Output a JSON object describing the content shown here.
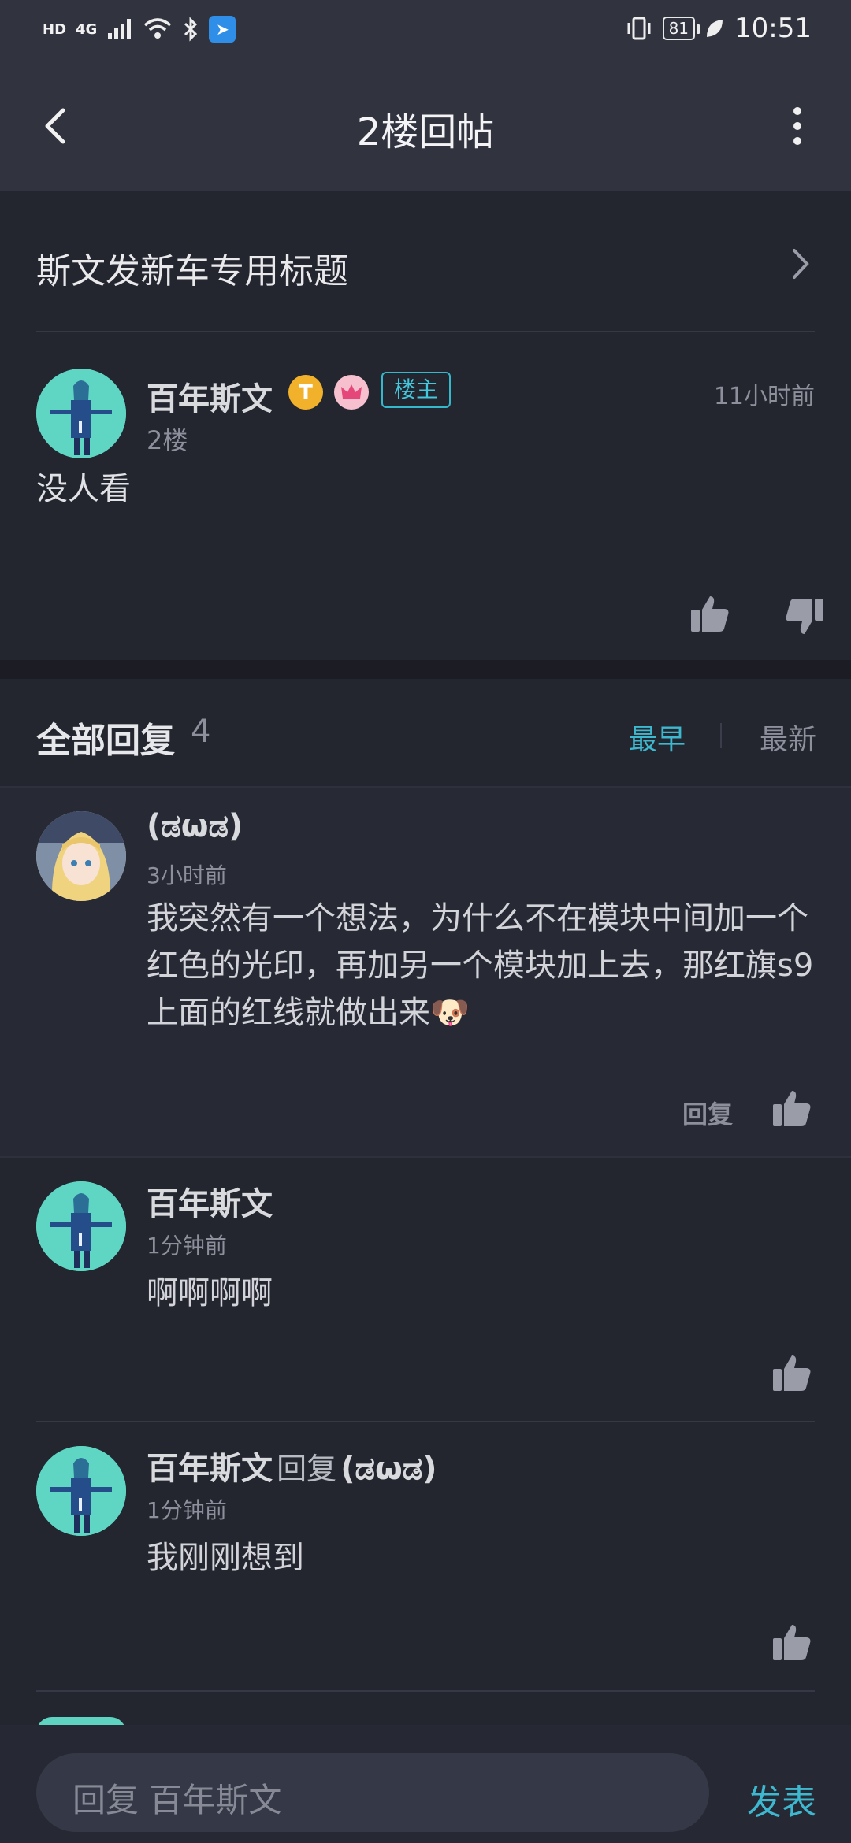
{
  "status_bar": {
    "hd": "HD",
    "net": "4G",
    "battery": "81",
    "time": "10:51"
  },
  "nav": {
    "title": "2楼回帖"
  },
  "thread": {
    "title": "斯文发新车专用标题"
  },
  "post": {
    "username": "百年斯文",
    "owner_tag": "楼主",
    "floor": "2楼",
    "time": "11小时前",
    "content": "没人看"
  },
  "replies_header": {
    "title": "全部回复",
    "count": "4",
    "sort_earliest": "最早",
    "sort_latest": "最新"
  },
  "replies": [
    {
      "username": "(ಡωಡ)",
      "time": "3小时前",
      "content": "我突然有一个想法，为什么不在模块中间加一个红色的光印，再加另一个模块加上去，那红旗s9上面的红线就做出来🐶",
      "reply_label": "回复"
    },
    {
      "username": "百年斯文",
      "time": "1分钟前",
      "content": "啊啊啊啊"
    },
    {
      "username": "百年斯文",
      "reply_word": "回复",
      "reply_target": "(ಡωಡ)",
      "time": "1分钟前",
      "content": "我刚刚想到"
    }
  ],
  "composer": {
    "placeholder": "回复 百年斯文",
    "send_label": "发表"
  },
  "colors": {
    "accent": "#3eb8cf",
    "background": "#23252f",
    "header": "#31343f"
  }
}
